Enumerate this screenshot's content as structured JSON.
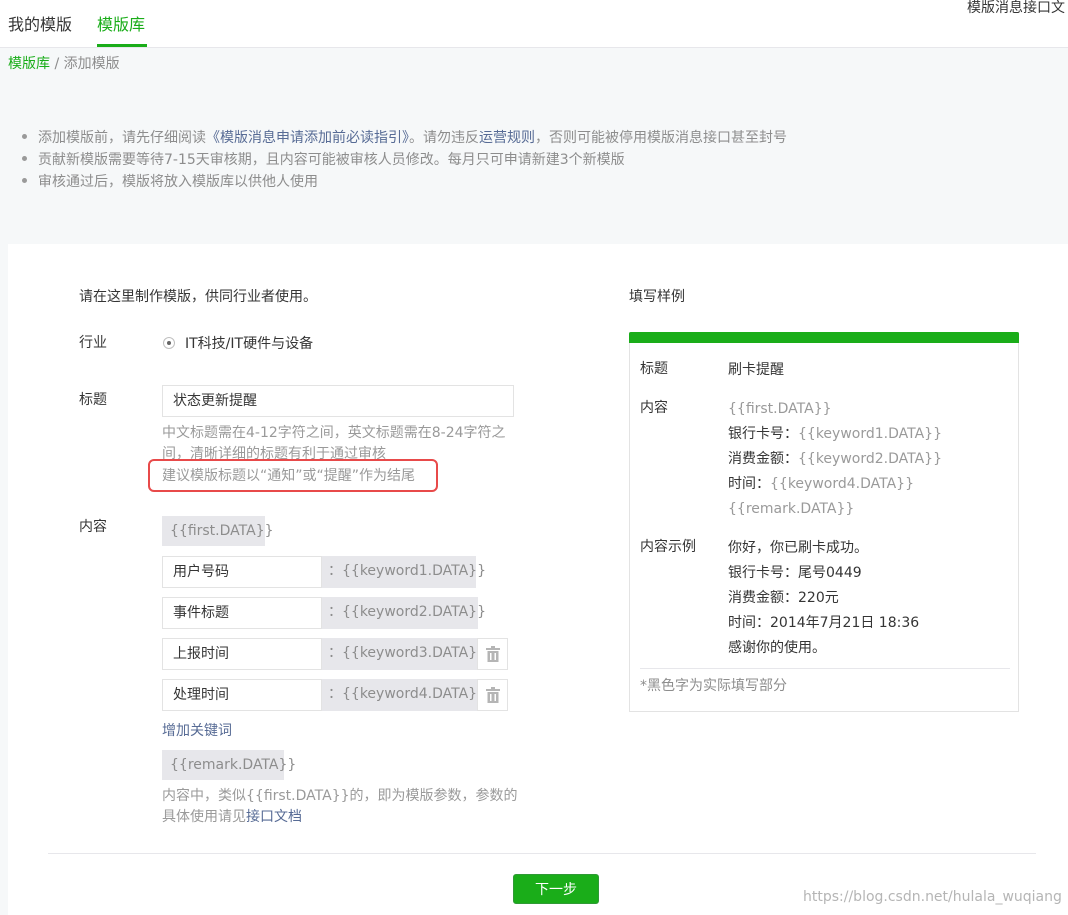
{
  "top_tabs": [
    {
      "label": "我的模版",
      "active": false
    },
    {
      "label": "模版库",
      "active": true
    }
  ],
  "top_right_link": "模版消息接口文",
  "breadcrumb": {
    "root": "模版库",
    "separator": " / ",
    "current": "添加模版"
  },
  "notices": {
    "line1_pre": "添加模版前，请先仔细阅读",
    "line1_link1": "《模版消息申请添加前必读指引》",
    "line1_mid": "。请勿违反",
    "line1_link2": "运营规则",
    "line1_post": "，否则可能被停用模版消息接口甚至封号",
    "line2": "贡献新模版需要等待7-15天审核期，且内容可能被审核人员修改。每月只可申请新建3个新模版",
    "line3": "审核通过后，模版将放入模版库以供他人使用"
  },
  "form": {
    "intro": "请在这里制作模版，供同行业者使用。",
    "industry_label": "行业",
    "industry_value": "IT科技/IT硬件与设备",
    "title_label": "标题",
    "title_value": "状态更新提醒",
    "title_hint_line1": "中文标题需在4-12字符之间，英文标题需在8-24字符之",
    "title_hint_line2": "间，清晰详细的标题有利于通过审核",
    "title_hint_line3": "建议模版标题以“通知”或“提醒”作为结尾",
    "content_label": "内容",
    "first_param": "{{first.DATA}}",
    "keywords": [
      {
        "name": "用户号码",
        "param": "：{{keyword1.DATA}}",
        "deletable": false
      },
      {
        "name": "事件标题",
        "param": "：{{keyword2.DATA}}",
        "deletable": false
      },
      {
        "name": "上报时间",
        "param": "：{{keyword3.DATA}}",
        "deletable": true
      },
      {
        "name": "处理时间",
        "param": "：{{keyword4.DATA}}",
        "deletable": true
      }
    ],
    "add_keyword": "增加关键词",
    "remark_param": "{{remark.DATA}}",
    "content_hint_line1": "内容中，类似{{first.DATA}}的，即为模版参数，参数的",
    "content_hint_line2_pre": "具体使用请见",
    "content_hint_line2_link": "接口文档"
  },
  "sample": {
    "heading": "填写样例",
    "title_label": "标题",
    "title_value": "刷卡提醒",
    "content_label": "内容",
    "content_lines": [
      {
        "label": "",
        "param": "{{first.DATA}}"
      },
      {
        "label": "银行卡号：",
        "param": "{{keyword1.DATA}}"
      },
      {
        "label": "消费金额：",
        "param": "{{keyword2.DATA}}"
      },
      {
        "label": "时间：",
        "param": "{{keyword4.DATA}}"
      },
      {
        "label": "",
        "param": "{{remark.DATA}}"
      }
    ],
    "example_label": "内容示例",
    "example_lines": [
      "你好，你已刷卡成功。",
      "银行卡号：尾号0449",
      "消费金额：220元",
      "时间：2014年7月21日 18:36",
      "感谢你的使用。"
    ],
    "footnote": "*黑色字为实际填写部分"
  },
  "next_button": "下一步",
  "watermark": "https://blog.csdn.net/hulala_wuqiang",
  "colors": {
    "brand_green": "#1aad19",
    "link_blue": "#576b95",
    "highlight_red": "#e84a4a"
  }
}
